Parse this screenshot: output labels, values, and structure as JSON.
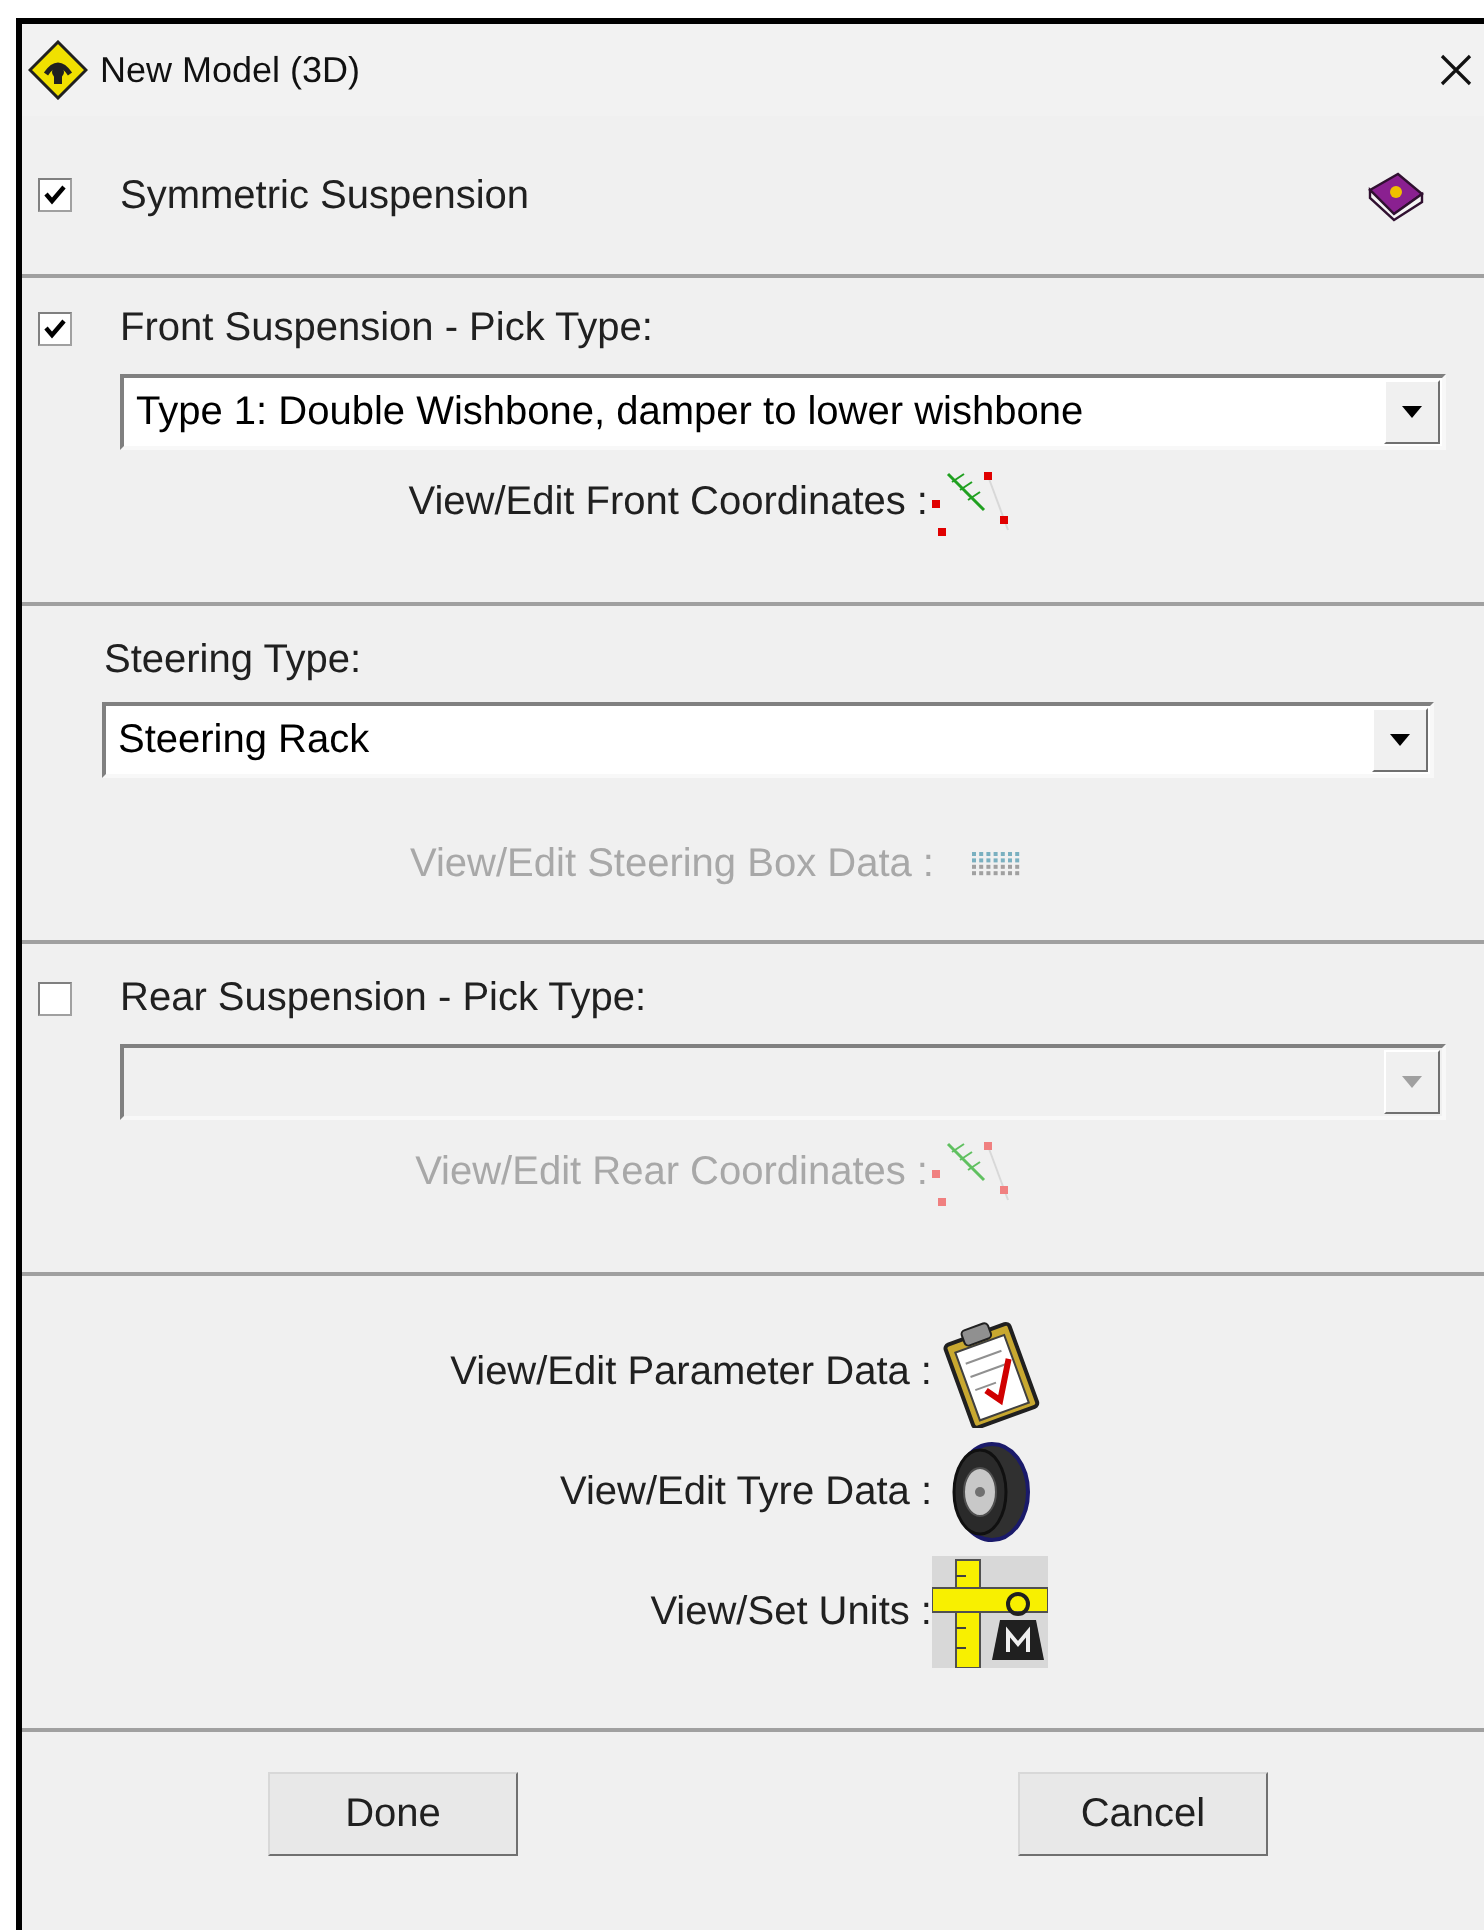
{
  "window": {
    "title": "New Model (3D)"
  },
  "symmetric": {
    "label": "Symmetric Suspension",
    "checked": true
  },
  "front": {
    "label": "Front Suspension - Pick Type:",
    "checked": true,
    "dropdown": {
      "value": "Type 1: Double Wishbone, damper to lower wishbone",
      "disabled": false
    },
    "link": {
      "label": "View/Edit Front Coordinates :",
      "disabled": false
    }
  },
  "steering": {
    "label": "Steering Type:",
    "dropdown": {
      "value": "Steering Rack",
      "disabled": false
    },
    "link": {
      "label": "View/Edit Steering Box Data :",
      "disabled": true
    }
  },
  "rear": {
    "label": "Rear Suspension - Pick Type:",
    "checked": false,
    "dropdown": {
      "disabled": true
    },
    "link": {
      "label": "View/Edit Rear Coordinates :",
      "disabled": true
    }
  },
  "data_links": [
    {
      "label": "View/Edit Parameter Data :"
    },
    {
      "label": "View/Edit Tyre Data :"
    },
    {
      "label": "View/Set Units :"
    }
  ],
  "buttons": [
    {
      "label": "Done"
    },
    {
      "label": "Cancel"
    }
  ]
}
